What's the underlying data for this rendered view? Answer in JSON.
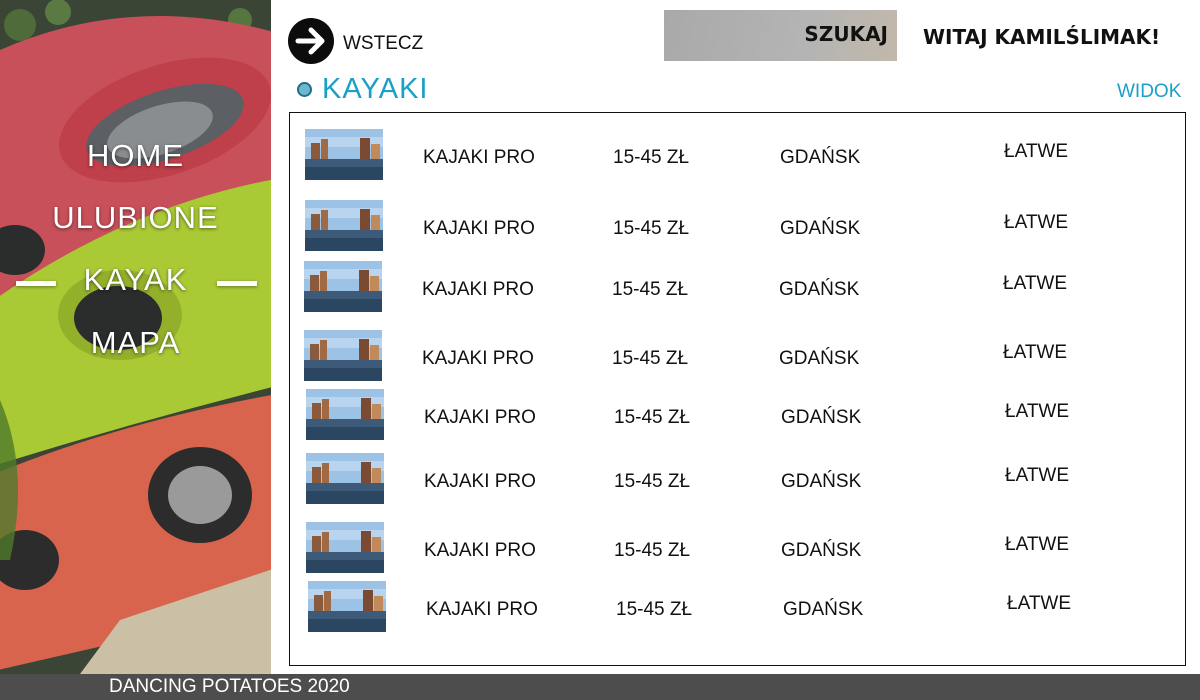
{
  "sidebar": {
    "nav": [
      {
        "label": "HOME"
      },
      {
        "label": "ULUBIONE"
      },
      {
        "label": "KAYAK",
        "active": true
      },
      {
        "label": "MAPA"
      }
    ]
  },
  "header": {
    "back_label": "WSTECZ",
    "back_icon": "arrow-right-icon",
    "search_label": "SZUKAJ",
    "greeting": "WITAJ KAMILŚLIMAK!"
  },
  "section": {
    "title": "KAYAKI",
    "view_label": "WIDOK"
  },
  "listings": [
    {
      "name": "KAJAKI PRO",
      "price": "15-45 ZŁ",
      "city": "GDAŃSK",
      "difficulty": "ŁATWE"
    },
    {
      "name": "KAJAKI PRO",
      "price": "15-45 ZŁ",
      "city": "GDAŃSK",
      "difficulty": "ŁATWE"
    },
    {
      "name": "KAJAKI PRO",
      "price": "15-45 ZŁ",
      "city": "GDAŃSK",
      "difficulty": "ŁATWE"
    },
    {
      "name": "KAJAKI PRO",
      "price": "15-45 ZŁ",
      "city": "GDAŃSK",
      "difficulty": "ŁATWE"
    },
    {
      "name": "KAJAKI PRO",
      "price": "15-45 ZŁ",
      "city": "GDAŃSK",
      "difficulty": "ŁATWE"
    },
    {
      "name": "KAJAKI PRO",
      "price": "15-45 ZŁ",
      "city": "GDAŃSK",
      "difficulty": "ŁATWE"
    },
    {
      "name": "KAJAKI PRO",
      "price": "15-45 ZŁ",
      "city": "GDAŃSK",
      "difficulty": "ŁATWE"
    },
    {
      "name": "KAJAKI PRO",
      "price": "15-45 ZŁ",
      "city": "GDAŃSK",
      "difficulty": "ŁATWE"
    }
  ],
  "footer": {
    "text": "DANCING POTATOES 2020"
  },
  "colors": {
    "accent": "#1aa0c8",
    "footer_bg": "#4d4d4d",
    "search_bg": "#b0b0b0"
  }
}
